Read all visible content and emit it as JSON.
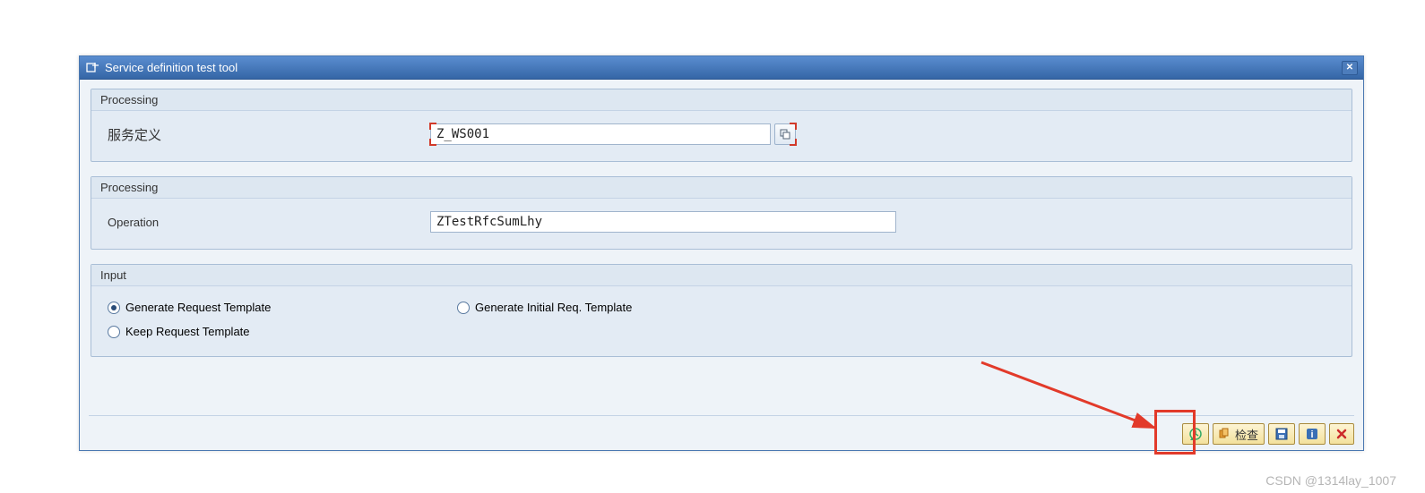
{
  "window": {
    "title": "Service definition test tool"
  },
  "group1": {
    "header": "Processing",
    "service_def_label": "服务定义",
    "service_def_value": "Z_WS001"
  },
  "group2": {
    "header": "Processing",
    "operation_label": "Operation",
    "operation_value": "ZTestRfcSumLhy"
  },
  "group3": {
    "header": "Input",
    "opt_generate": "Generate Request Template",
    "opt_initial": "Generate Initial Req. Template",
    "opt_keep": "Keep Request Template",
    "selected": "generate"
  },
  "footer": {
    "check_label": "检查"
  },
  "watermark": "CSDN @1314lay_1007"
}
